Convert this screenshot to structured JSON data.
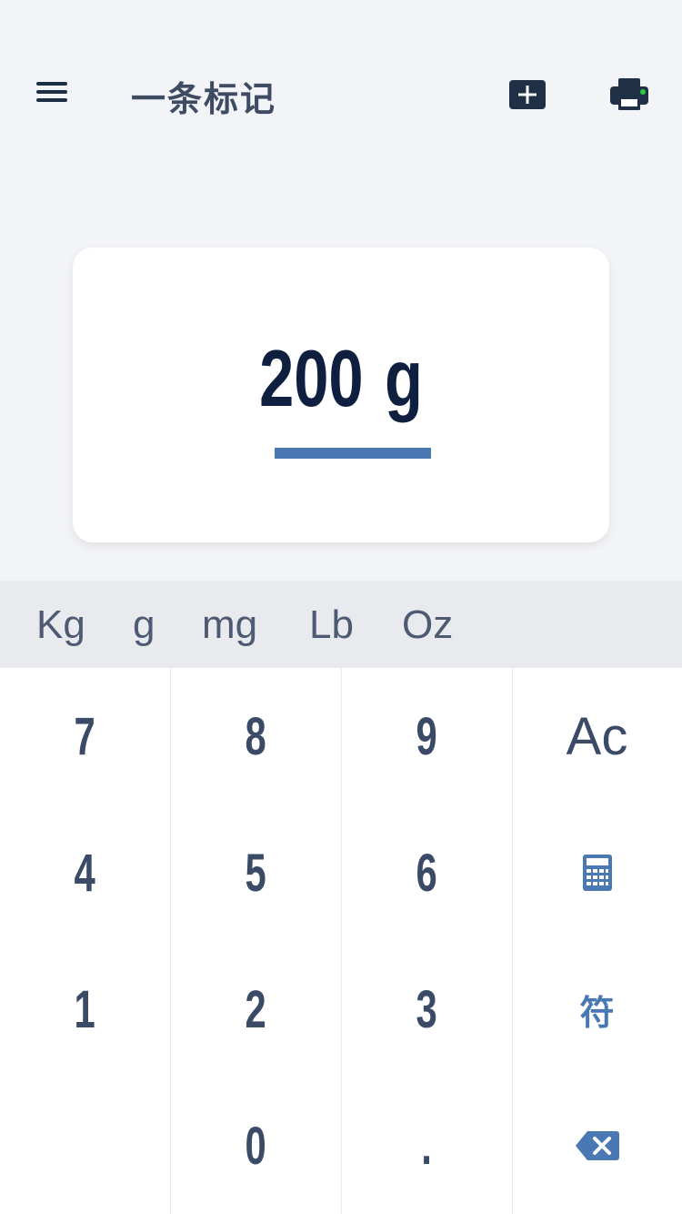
{
  "header": {
    "title": "一条标记",
    "menu_icon": "hamburger-menu-icon",
    "add_icon": "add-box-icon",
    "print_icon": "printer-icon"
  },
  "display": {
    "value": "200",
    "unit": "g"
  },
  "units": [
    "Kg",
    "g",
    "mg",
    "Lb",
    "Oz"
  ],
  "keypad": {
    "k7": "7",
    "k8": "8",
    "k9": "9",
    "ac": "Ac",
    "k4": "4",
    "k5": "5",
    "k6": "6",
    "calculator_icon": "calculator-icon",
    "k1": "1",
    "k2": "2",
    "k3": "3",
    "symbol": "符",
    "k0": "0",
    "dot": ".",
    "backspace_icon": "backspace-icon"
  },
  "colors": {
    "background": "#f3f4f7",
    "primary_text": "#0e1f3f",
    "accent": "#4a78b2",
    "key_text": "#3b4a66",
    "status_dot": "#2ecc40"
  }
}
